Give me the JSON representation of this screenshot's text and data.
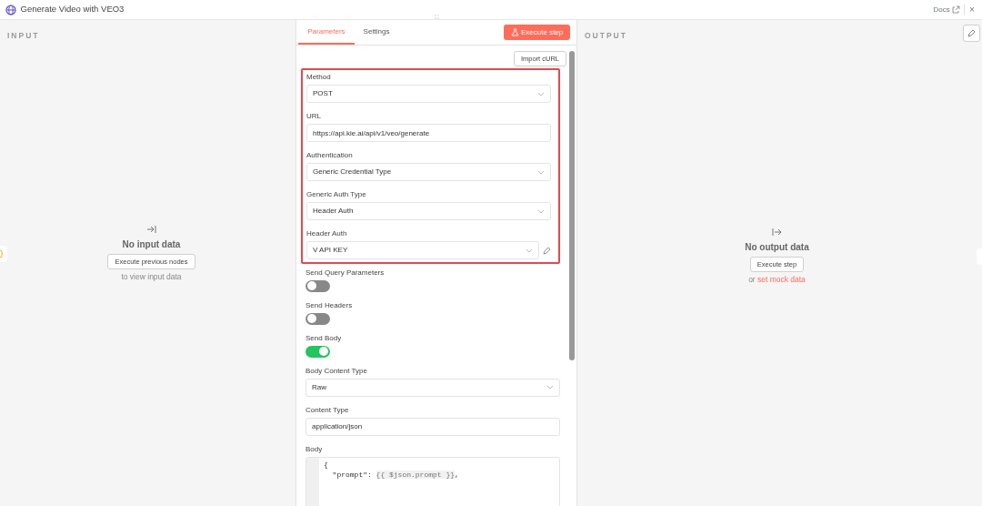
{
  "window": {
    "title": "Generate Video with VEO3",
    "docs_link": "Docs",
    "close": "×"
  },
  "input_panel": {
    "heading": "INPUT",
    "message": "No input data",
    "button": "Execute previous nodes",
    "hint": "to view input data"
  },
  "tabs": [
    {
      "label": "Parameters",
      "selected": true
    },
    {
      "label": "Settings",
      "selected": false
    }
  ],
  "execute_button": "Execute step",
  "import_button": "Import cURL",
  "parameters": [
    {
      "kind": "select",
      "label": "Method",
      "value": "POST",
      "highlighted": true
    },
    {
      "kind": "input",
      "label": "URL",
      "value": "https://api.kie.ai/api/v1/veo/generate",
      "highlighted": true
    },
    {
      "kind": "select",
      "label": "Authentication",
      "value": "Generic Credential Type",
      "highlighted": true
    },
    {
      "kind": "select",
      "label": "Generic Auth Type",
      "value": "Header Auth",
      "highlighted": true
    },
    {
      "kind": "credential",
      "label": "Header Auth",
      "value": "V API KEY",
      "highlighted": true
    },
    {
      "kind": "toggle",
      "label": "Send Query Parameters",
      "on": false,
      "highlighted": false
    },
    {
      "kind": "toggle",
      "label": "Send Headers",
      "on": false,
      "highlighted": false
    },
    {
      "kind": "toggle",
      "label": "Send Body",
      "on": true,
      "highlighted": false
    },
    {
      "kind": "select",
      "label": "Body Content Type",
      "value": "Raw",
      "highlighted": false
    },
    {
      "kind": "input",
      "label": "Content Type",
      "value": "application/json",
      "highlighted": false
    },
    {
      "kind": "code",
      "label": "Body",
      "highlighted": false,
      "lines": [
        [
          {
            "kind": "plain",
            "text": "{"
          }
        ],
        [
          {
            "kind": "plain",
            "text": "  \"prompt\": "
          },
          {
            "kind": "expression",
            "text": "{{ $json.prompt }}"
          },
          {
            "kind": "plain",
            "text": ","
          }
        ]
      ]
    }
  ],
  "output_panel": {
    "heading": "OUTPUT",
    "message": "No output data",
    "button": "Execute step",
    "hint_prefix": "or",
    "hint_link": "set mock data"
  }
}
